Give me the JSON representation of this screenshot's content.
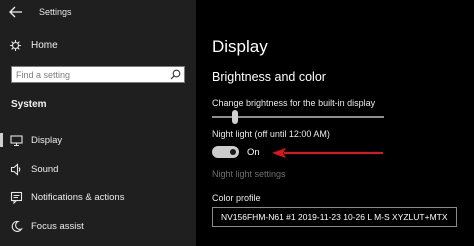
{
  "window": {
    "title": "Settings"
  },
  "sidebar": {
    "home_label": "Home",
    "search": {
      "placeholder": "Find a setting",
      "value": ""
    },
    "section_label": "System",
    "items": [
      {
        "label": "Display",
        "icon": "display-icon",
        "selected": true
      },
      {
        "label": "Sound",
        "icon": "speaker-icon",
        "selected": false
      },
      {
        "label": "Notifications & actions",
        "icon": "notifications-icon",
        "selected": false
      },
      {
        "label": "Focus assist",
        "icon": "moon-icon",
        "selected": false
      }
    ]
  },
  "main": {
    "title": "Display",
    "section_heading": "Brightness and color",
    "brightness": {
      "label": "Change brightness for the built-in display",
      "value_percent": 12
    },
    "night_light": {
      "label": "Night light (off until 12:00 AM)",
      "state": "On"
    },
    "night_light_settings_link": "Night light settings",
    "color_profile": {
      "label": "Color profile",
      "value": "NV156FHM-N61 #1 2019-11-23 10-26 L M-S XYZLUT+MTX"
    }
  },
  "colors": {
    "annotation_arrow": "#e0141c",
    "sidebar_bg": "#1f1f1f",
    "main_bg": "#000000"
  }
}
